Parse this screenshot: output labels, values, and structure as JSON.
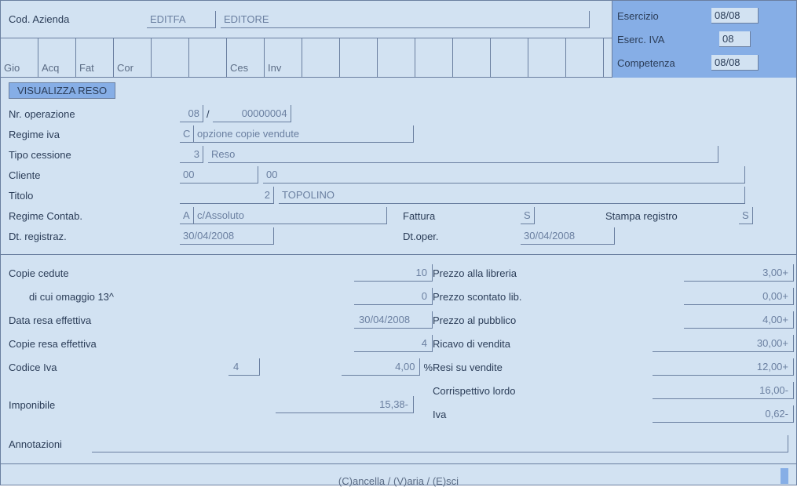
{
  "header": {
    "cod_azienda_label": "Cod. Azienda",
    "cod_azienda_code": "EDITFA",
    "cod_azienda_name": "EDITORE",
    "esercizio_label": "Esercizio",
    "esercizio_val": "08/08",
    "eserc_iva_label": "Eserc. IVA",
    "eserc_iva_val": "08",
    "competenza_label": "Competenza",
    "competenza_val": "08/08"
  },
  "tabs": [
    "Gio",
    "Acq",
    "Fat",
    "Cor",
    "",
    "",
    "Ces",
    "Inv",
    "",
    "",
    "",
    "",
    "",
    "",
    "",
    ""
  ],
  "group_title": "VISUALIZZA RESO",
  "fields": {
    "nr_operazione_label": "Nr. operazione",
    "nr_operazione_a": "08",
    "nr_operazione_sep": "/",
    "nr_operazione_b": "00000004",
    "regime_iva_label": "Regime iva",
    "regime_iva_code": "C",
    "regime_iva_desc": "opzione copie vendute",
    "tipo_cessione_label": "Tipo cessione",
    "tipo_cessione_code": "3",
    "tipo_cessione_desc": "Reso",
    "cliente_label": "Cliente",
    "cliente_a": "00",
    "cliente_b": "00",
    "titolo_label": "Titolo",
    "titolo_code": "2",
    "titolo_desc": "TOPOLINO",
    "regime_contab_label": "Regime Contab.",
    "regime_contab_code": "A",
    "regime_contab_desc": "c/Assoluto",
    "fattura_label": "Fattura",
    "fattura_val": "S",
    "stampa_registro_label": "Stampa registro",
    "stampa_registro_val": "S",
    "dt_registraz_label": "Dt. registraz.",
    "dt_registraz_val": "30/04/2008",
    "dt_oper_label": "Dt.oper.",
    "dt_oper_val": "30/04/2008"
  },
  "calc": {
    "copie_cedute_label": "Copie cedute",
    "copie_cedute_val": "10",
    "di_cui_omaggio_label": "di cui omaggio 13^",
    "di_cui_omaggio_val": "0",
    "data_resa_eff_label": "Data resa effettiva",
    "data_resa_eff_val": "30/04/2008",
    "copie_resa_eff_label": "Copie resa effettiva",
    "copie_resa_eff_val": "4",
    "codice_iva_label": "Codice Iva",
    "codice_iva_code": "4",
    "codice_iva_pct": "4,00",
    "pct_sign": "%",
    "imponibile_label": "Imponibile",
    "imponibile_val": "15,38-",
    "prezzo_libreria_label": "Prezzo alla libreria",
    "prezzo_libreria_val": "3,00+",
    "prezzo_scontato_label": "Prezzo scontato lib.",
    "prezzo_scontato_val": "0,00+",
    "prezzo_pubblico_label": "Prezzo al pubblico",
    "prezzo_pubblico_val": "4,00+",
    "ricavo_vendita_label": "Ricavo di vendita",
    "ricavo_vendita_val": "30,00+",
    "resi_vendite_label": "Resi su vendite",
    "resi_vendite_val": "12,00+",
    "corrispettivo_label": "Corrispettivo lordo",
    "corrispettivo_val": "16,00-",
    "iva_label": "Iva",
    "iva_val": "0,62-",
    "annotazioni_label": "Annotazioni"
  },
  "footer": "(C)ancella / (V)aria / (E)sci"
}
